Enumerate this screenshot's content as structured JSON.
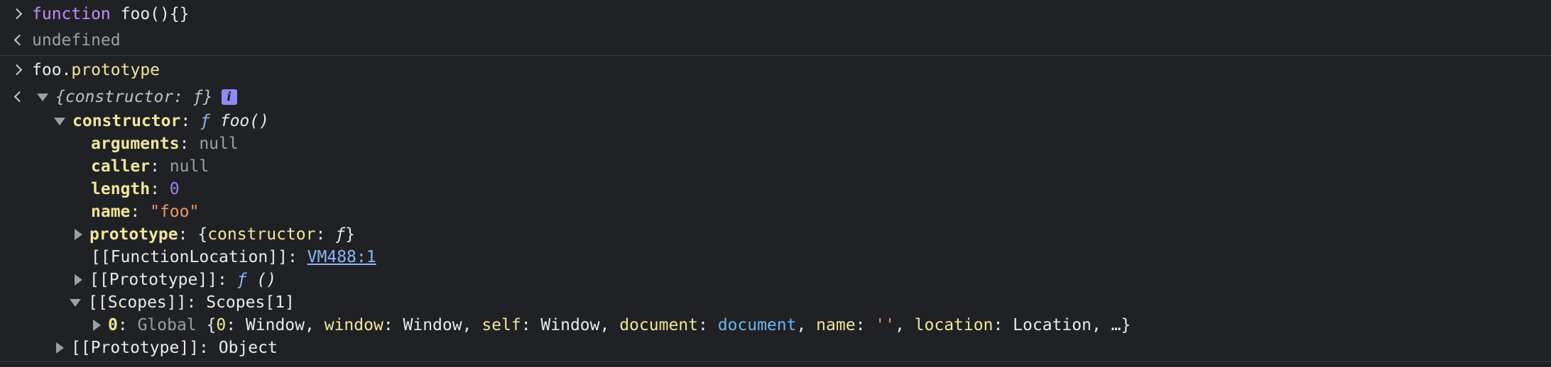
{
  "entries": [
    {
      "input": {
        "keyword": "function",
        "rest": " foo(){}"
      },
      "output": "undefined"
    },
    {
      "input": {
        "object": "foo",
        "dot": ".",
        "property": "prototype"
      },
      "summary": {
        "text": "{constructor: ",
        "f": "ƒ",
        "close": "}"
      },
      "info_badge": "i"
    }
  ],
  "tree": {
    "constructor": {
      "key": "constructor",
      "colon": ": ",
      "f": "ƒ",
      "value": " foo()"
    },
    "arguments": {
      "key": "arguments",
      "colon": ": ",
      "value": "null"
    },
    "caller": {
      "key": "caller",
      "colon": ": ",
      "value": "null"
    },
    "length": {
      "key": "length",
      "colon": ": ",
      "value": "0"
    },
    "name": {
      "key": "name",
      "colon": ": ",
      "value": "\"foo\""
    },
    "prototype": {
      "key": "prototype",
      "colon": ": ",
      "pre": "{",
      "subkey": "constructor",
      "sep": ": ",
      "f": "ƒ",
      "post": "}"
    },
    "function_location": {
      "key": "[[FunctionLocation]]",
      "colon": ": ",
      "link": "VM488:1"
    },
    "inner_prototype": {
      "key": "[[Prototype]]",
      "colon": ": ",
      "f": "ƒ",
      "value": " ()"
    },
    "scopes": {
      "key": "[[Scopes]]",
      "colon": ": ",
      "value": "Scopes[1]"
    },
    "scope0": {
      "index": "0",
      "colon": ": ",
      "label": "Global",
      "open": " {",
      "k1": "0",
      "v1": "Window",
      "k2": "window",
      "v2": "Window",
      "k3": "self",
      "v3": "Window",
      "k4": "document",
      "v4": "document",
      "k5": "name",
      "v5": "''",
      "k6": "location",
      "v6": "Location",
      "tail": ", …}"
    },
    "outer_prototype": {
      "key": "[[Prototype]]",
      "colon": ": ",
      "value": "Object"
    }
  }
}
